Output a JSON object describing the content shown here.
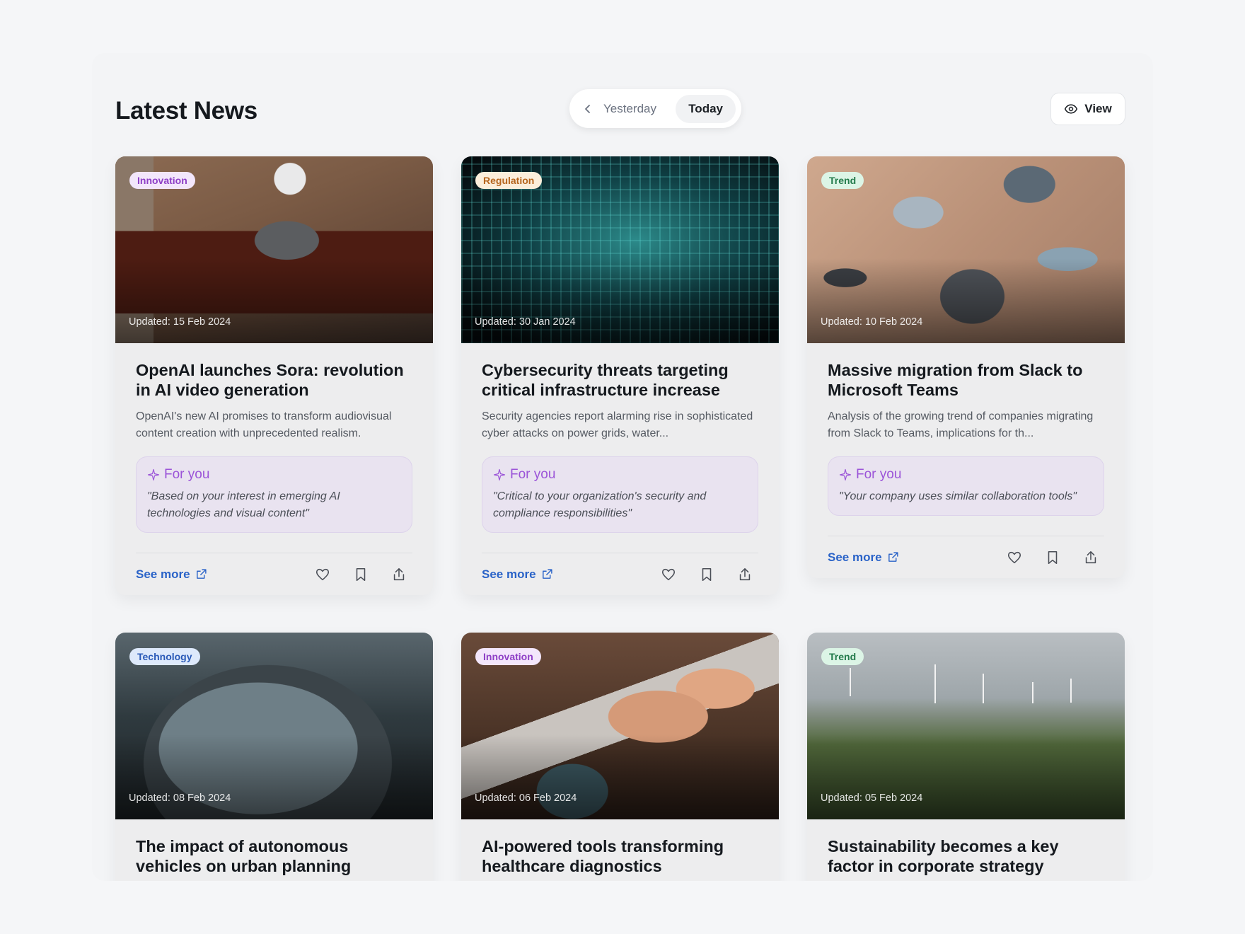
{
  "header": {
    "title": "Latest News",
    "day_toggle": {
      "yesterday": "Yesterday",
      "today": "Today",
      "selected": "Today"
    },
    "view_label": "View"
  },
  "colors": {
    "link": "#2a63c8",
    "for_you_accent": "#9b54d8",
    "tag_innovation": "#8e3fc6",
    "tag_regulation": "#b5651d",
    "tag_trend": "#237b4b",
    "tag_technology": "#2a5ab8"
  },
  "cards": [
    {
      "tag": "Innovation",
      "updated": "Updated: 15 Feb 2024",
      "headline": "OpenAI launches Sora: revolution in AI video generation",
      "summary": "OpenAI's new AI promises to transform audiovisual content creation with unprecedented realism.",
      "for_you_label": "For you",
      "for_you_quote": "\"Based on your interest in emerging AI technologies and visual content\"",
      "see_more": "See more",
      "image": "robot-reading-tablet"
    },
    {
      "tag": "Regulation",
      "updated": "Updated: 30 Jan 2024",
      "headline": "Cybersecurity threats targeting critical infrastructure increase",
      "summary": "Security agencies report alarming rise in sophisticated cyber attacks on power grids, water...",
      "for_you_label": "For you",
      "for_you_quote": "\"Critical to your organization's security and compliance responsibilities\"",
      "see_more": "See more",
      "image": "circuit-board"
    },
    {
      "tag": "Trend",
      "updated": "Updated: 10 Feb 2024",
      "headline": "Massive migration from Slack to Microsoft Teams",
      "summary": "Analysis of the growing trend of companies migrating from Slack to Teams, implications for th...",
      "for_you_label": "For you",
      "for_you_quote": "\"Your company uses similar collaboration tools\"",
      "see_more": "See more",
      "image": "team-desk-laptops"
    },
    {
      "tag": "Technology",
      "updated": "Updated: 08 Feb 2024",
      "headline": "The impact of autonomous vehicles on urban planning",
      "image": "car"
    },
    {
      "tag": "Innovation",
      "updated": "Updated: 06 Feb 2024",
      "headline": "AI-powered tools transforming healthcare diagnostics",
      "image": "laptop-stethoscope"
    },
    {
      "tag": "Trend",
      "updated": "Updated: 05 Feb 2024",
      "headline": "Sustainability becomes a key factor in corporate strategy",
      "image": "wind-turbines"
    }
  ]
}
